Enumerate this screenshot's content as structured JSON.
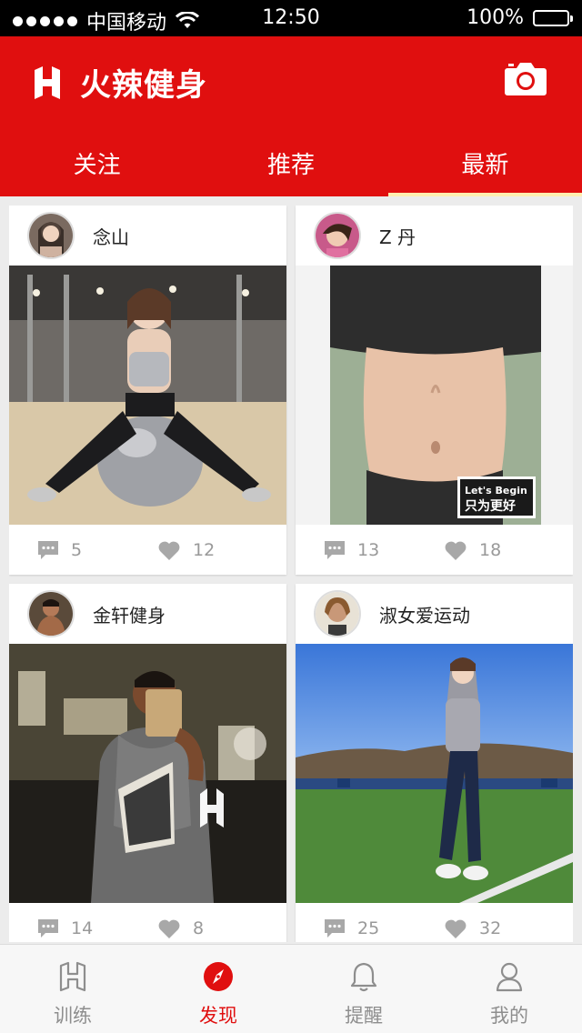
{
  "status_bar": {
    "carrier": "中国移动",
    "time": "12:50",
    "battery": "100%"
  },
  "header": {
    "app_title": "火辣健身",
    "tabs": [
      {
        "label": "关注",
        "active": false
      },
      {
        "label": "推荐",
        "active": false
      },
      {
        "label": "最新",
        "active": true
      }
    ],
    "accent_color": "#e00f0f",
    "active_tab_underline_color": "#ffeeb0"
  },
  "feed": {
    "posts": [
      {
        "user": "念山",
        "comments": "5",
        "likes": "12"
      },
      {
        "user": "Z 丹",
        "comments": "13",
        "likes": "18",
        "photo_badge": {
          "line1": "Let's Begin",
          "line2": "只为更好"
        }
      },
      {
        "user": "金轩健身",
        "comments": "14",
        "likes": "8"
      },
      {
        "user": "淑女爱运动",
        "comments": "25",
        "likes": "32"
      }
    ]
  },
  "bottom_nav": {
    "items": [
      {
        "label": "训练",
        "icon": "logo-h-icon",
        "active": false
      },
      {
        "label": "发现",
        "icon": "compass-icon",
        "active": true
      },
      {
        "label": "提醒",
        "icon": "bell-icon",
        "active": false
      },
      {
        "label": "我的",
        "icon": "person-icon",
        "active": false
      }
    ]
  }
}
